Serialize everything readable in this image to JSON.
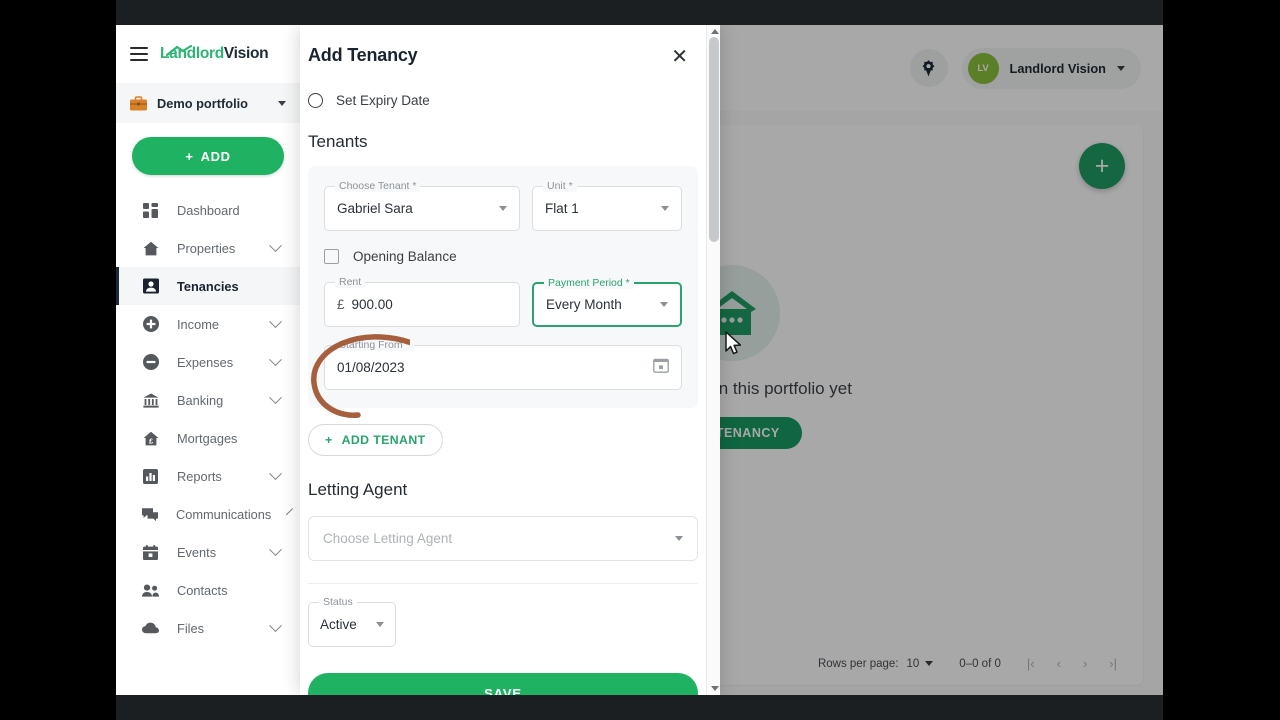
{
  "sidebar": {
    "logo": {
      "part1": "Landlord",
      "part2": "Vision",
      "icon": "house-roof-icon"
    },
    "menu_icon": "hamburger-menu-icon",
    "portfolio": {
      "label": "Demo portfolio",
      "icon": "briefcase-icon"
    },
    "add_button": {
      "label": "ADD",
      "icon": "plus-icon"
    },
    "items": [
      {
        "label": "Dashboard",
        "icon": "dashboard-icon",
        "expandable": false,
        "active": false
      },
      {
        "label": "Properties",
        "icon": "home-icon",
        "expandable": true,
        "active": false
      },
      {
        "label": "Tenancies",
        "icon": "person-card-icon",
        "expandable": false,
        "active": true
      },
      {
        "label": "Income",
        "icon": "plus-circle-icon",
        "expandable": true,
        "active": false
      },
      {
        "label": "Expenses",
        "icon": "minus-circle-icon",
        "expandable": true,
        "active": false
      },
      {
        "label": "Banking",
        "icon": "bank-icon",
        "expandable": true,
        "active": false
      },
      {
        "label": "Mortgages",
        "icon": "house-pound-icon",
        "expandable": false,
        "active": false
      },
      {
        "label": "Reports",
        "icon": "bar-chart-icon",
        "expandable": true,
        "active": false
      },
      {
        "label": "Communications",
        "icon": "chat-bubbles-icon",
        "expandable": true,
        "active": false
      },
      {
        "label": "Events",
        "icon": "calendar-icon",
        "expandable": true,
        "active": false
      },
      {
        "label": "Contacts",
        "icon": "people-icon",
        "expandable": false,
        "active": false
      },
      {
        "label": "Files",
        "icon": "cloud-icon",
        "expandable": true,
        "active": false
      }
    ]
  },
  "header": {
    "gear_icon": "settings-gear-icon",
    "avatar_initials": "LV",
    "user_name": "Landlord Vision",
    "chevron_icon": "chevron-down-icon"
  },
  "background": {
    "fab_label": "+",
    "empty_icon": "house-dots-icon",
    "empty_text": "No tenancies in this portfolio yet",
    "empty_text_visible": "cies in this portfolio yet",
    "empty_button": "ADD TENANCY",
    "empty_button_visible": "D TENANCY",
    "paginator": {
      "rows_per_page_label": "Rows per page:",
      "rows_per_page_value": "10",
      "range": "0–0 of 0",
      "first_icon": "|‹",
      "prev_icon": "‹",
      "next_icon": "›",
      "last_icon": "›|"
    }
  },
  "modal": {
    "title": "Add Tenancy",
    "close_icon": "close-icon",
    "expiry": {
      "label": "Set Expiry Date",
      "checked": false
    },
    "tenants_heading": "Tenants",
    "fields": {
      "choose_tenant": {
        "label": "Choose Tenant *",
        "value": "Gabriel Sara"
      },
      "unit": {
        "label": "Unit *",
        "value": "Flat 1"
      },
      "opening_balance": {
        "label": "Opening Balance",
        "checked": false
      },
      "rent": {
        "label": "Rent",
        "currency": "£",
        "value": "900.00"
      },
      "payment_period": {
        "label": "Payment Period *",
        "value": "Every Month",
        "focused": true
      },
      "starting_from": {
        "label": "Starting From *",
        "value": "01/08/2023",
        "icon": "calendar-icon"
      }
    },
    "add_tenant_button": {
      "label": "ADD TENANT",
      "icon": "plus-icon"
    },
    "letting_agent_heading": "Letting Agent",
    "letting_agent": {
      "placeholder": "Choose Letting Agent",
      "value": ""
    },
    "status": {
      "label": "Status",
      "value": "Active"
    },
    "save_button": "SAVE"
  },
  "colors": {
    "brand_green": "#20b263",
    "accent_green": "#2aa36f",
    "dark_text": "#1b2330",
    "annotation_brown": "#a0522d",
    "avatar_green": "#8bbf3f",
    "portfolio_orange": "#d9822b"
  }
}
